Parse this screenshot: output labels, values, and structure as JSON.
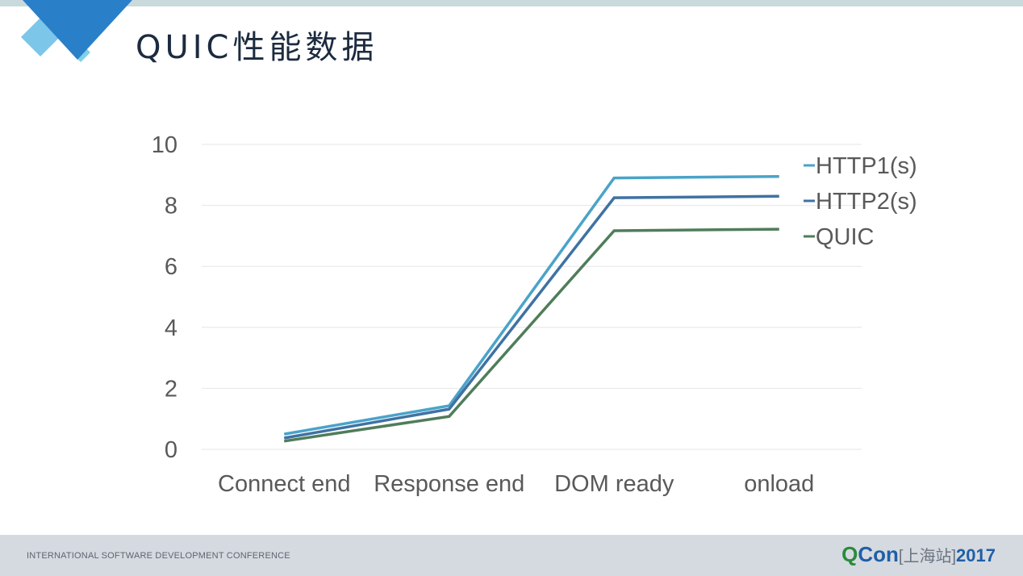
{
  "slide": {
    "title": "QUIC性能数据"
  },
  "footer": {
    "conference": "INTERNATIONAL SOFTWARE DEVELOPMENT CONFERENCE",
    "brand_q": "Q",
    "brand_con": "Con",
    "brand_location": "[上海站]",
    "brand_year": "2017"
  },
  "colors": {
    "HTTP1(s)": "#4aa3c9",
    "HTTP2(s)": "#3f72a3",
    "QUIC": "#4f7d5a"
  },
  "chart_data": {
    "type": "line",
    "title": "",
    "xlabel": "",
    "ylabel": "",
    "categories": [
      "Connect end",
      "Response end",
      "DOM ready",
      "onload"
    ],
    "ylim": [
      0,
      10
    ],
    "yticks": [
      0,
      2,
      4,
      6,
      8,
      10
    ],
    "grid": true,
    "legend_position": "right",
    "series": [
      {
        "name": "HTTP1(s)",
        "values": [
          0.5,
          1.43,
          8.9,
          8.95
        ]
      },
      {
        "name": "HTTP2(s)",
        "values": [
          0.37,
          1.32,
          8.25,
          8.3
        ]
      },
      {
        "name": "QUIC",
        "values": [
          0.27,
          1.08,
          7.17,
          7.22
        ]
      }
    ]
  }
}
